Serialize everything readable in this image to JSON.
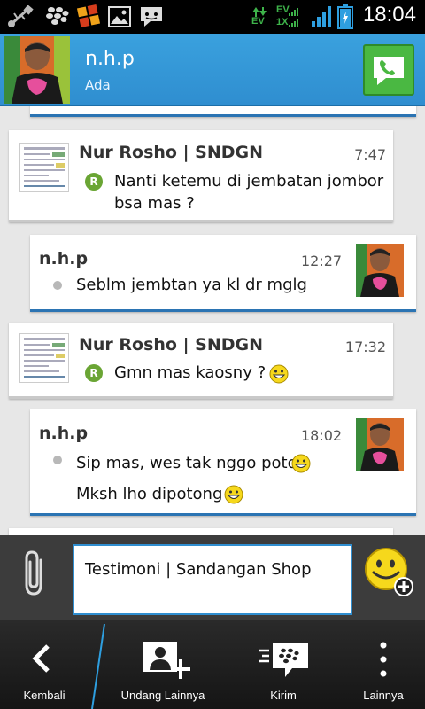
{
  "status_bar": {
    "time": "18:04",
    "network_label_1": "EV",
    "network_label_2": "EV",
    "network_label_3": "1X"
  },
  "header": {
    "contact_name": "n.h.p",
    "contact_status": "Ada"
  },
  "messages": [
    {
      "direction": "in",
      "sender": "Nur Rosho  | SNDGN",
      "time": "7:47",
      "text_lines": [
        "Nanti ketemu di jembatan jombor",
        "bsa mas ?"
      ],
      "badge": "R"
    },
    {
      "direction": "out",
      "sender": "n.h.p",
      "time": "12:27",
      "text_lines": [
        "Seblm jembtan ya kl dr mglg"
      ]
    },
    {
      "direction": "in",
      "sender": "Nur Rosho  | SNDGN",
      "time": "17:32",
      "text_lines": [
        "Gmn mas kaosny ? "
      ],
      "badge": "R"
    },
    {
      "direction": "out",
      "sender": "n.h.p",
      "time": "18:02",
      "text_lines": [
        "Sip mas, wes tak nggo poto",
        "Mksh lho dipotong"
      ]
    }
  ],
  "composer": {
    "text": "Testimoni | Sandangan Shop"
  },
  "actions": {
    "back": "Kembali",
    "invite_more": "Undang Lainnya",
    "send": "Kirim",
    "more": "Lainnya"
  },
  "colors": {
    "header_blue": "#3aa1de",
    "accent_blue": "#2b74b3",
    "call_green": "#4ab842",
    "read_badge_green": "#6aa534",
    "emoji_yellow": "#f6d81c"
  },
  "icons": [
    "usb-icon",
    "blackberry-icon",
    "app-grid-icon",
    "gallery-icon",
    "bbm-chat-icon",
    "signal-icon",
    "battery-icon",
    "phone-icon",
    "paperclip-icon",
    "emoji-add-icon",
    "back-chevron-icon",
    "add-contact-icon",
    "bbm-send-icon",
    "overflow-menu-icon"
  ]
}
